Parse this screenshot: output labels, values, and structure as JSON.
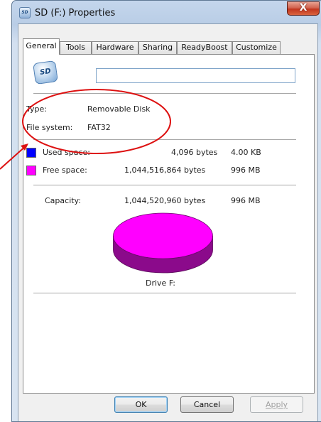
{
  "window": {
    "title": "SD (F:) Properties",
    "close_glyph": "X"
  },
  "tabs": [
    {
      "label": "General",
      "active": true
    },
    {
      "label": "Tools",
      "active": false
    },
    {
      "label": "Hardware",
      "active": false
    },
    {
      "label": "Sharing",
      "active": false
    },
    {
      "label": "ReadyBoost",
      "active": false
    },
    {
      "label": "Customize",
      "active": false
    }
  ],
  "drive": {
    "icon": "sd-card-icon",
    "icon_text": "SD",
    "name_value": ""
  },
  "info": {
    "type_label": "Type:",
    "type_value": "Removable Disk",
    "fs_label": "File system:",
    "fs_value": "FAT32"
  },
  "space": {
    "used": {
      "label": "Used space:",
      "bytes": "4,096 bytes",
      "size": "4.00 KB",
      "color": "#0000ff"
    },
    "free": {
      "label": "Free space:",
      "bytes": "1,044,516,864 bytes",
      "size": "996 MB",
      "color": "#ff00ff"
    },
    "capacity": {
      "label": "Capacity:",
      "bytes": "1,044,520,960 bytes",
      "size": "996 MB"
    }
  },
  "pie": {
    "used_fraction": 3.9e-06,
    "free_color": "#ff00ff",
    "free_shadow": "#8b0a8b"
  },
  "drive_label": "Drive F:",
  "buttons": {
    "ok": "OK",
    "cancel": "Cancel",
    "apply": "Apply"
  },
  "annotation": {
    "color": "#dd1111"
  }
}
